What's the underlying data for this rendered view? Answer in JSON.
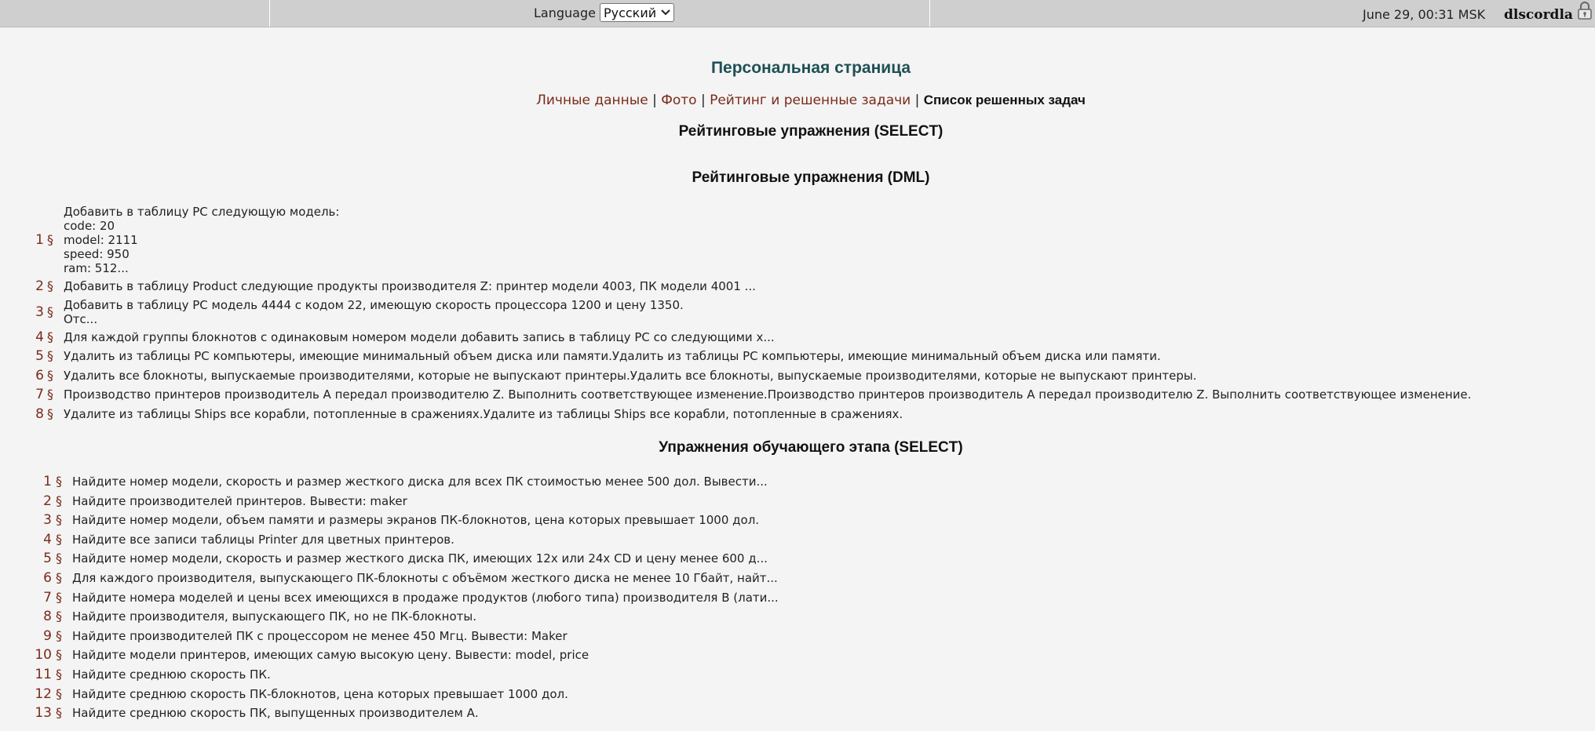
{
  "topbar": {
    "language_label": "Language",
    "language_selected": "Русский",
    "datetime": "June 29, 00:31 MSK",
    "username": "dlscordla"
  },
  "page": {
    "title": "Персональная страница",
    "nav": {
      "personal": "Личные данные",
      "photo": "Фото",
      "rating": "Рейтинг и решенные задачи",
      "solved_list": "Список решенных задач"
    }
  },
  "sections": {
    "rating_select": "Рейтинговые упражнения (SELECT)",
    "rating_dml": "Рейтинговые упражнения (DML)",
    "training_select": "Упражнения обучающего этапа (SELECT)"
  },
  "dml_items": [
    {
      "num": "1",
      "text": "Добавить в таблицу PC следующую модель:\ncode: 20\nmodel: 2111\nspeed: 950\nram: 512..."
    },
    {
      "num": "2",
      "text": "Добавить в таблицу Product следующие продукты производителя Z: принтер модели 4003, ПК модели 4001 ..."
    },
    {
      "num": "3",
      "text": "Добавить в таблицу PC модель 4444 с кодом 22, имеющую скорость процессора 1200 и цену 1350.\nОтс..."
    },
    {
      "num": "4",
      "text": "Для каждой группы блокнотов с одинаковым номером модели добавить запись в таблицу PC со следующими х..."
    },
    {
      "num": "5",
      "text": "Удалить из таблицы PC компьютеры, имеющие минимальный объем диска или памяти.Удалить из таблицы PC компьютеры, имеющие минимальный объем диска или памяти."
    },
    {
      "num": "6",
      "text": "Удалить все блокноты, выпускаемые производителями, которые не выпускают принтеры.Удалить все блокноты, выпускаемые производителями, которые не выпускают принтеры."
    },
    {
      "num": "7",
      "text": "Производство принтеров производитель A передал производителю Z. Выполнить соответствующее изменение.Производство принтеров производитель A передал производителю Z. Выполнить соответствующее изменение."
    },
    {
      "num": "8",
      "text": "Удалите из таблицы Ships все корабли, потопленные в сражениях.Удалите из таблицы Ships все корабли, потопленные в сражениях."
    }
  ],
  "training_items": [
    {
      "num": "1",
      "text": "Найдите номер модели, скорость и размер жесткого диска для всех ПК стоимостью менее 500 дол. Вывести..."
    },
    {
      "num": "2",
      "text": "Найдите производителей принтеров. Вывести: maker"
    },
    {
      "num": "3",
      "text": "Найдите номер модели, объем памяти и размеры экранов ПК-блокнотов, цена которых превышает 1000 дол."
    },
    {
      "num": "4",
      "text": "Найдите все записи таблицы Printer для цветных принтеров."
    },
    {
      "num": "5",
      "text": "Найдите номер модели, скорость и размер жесткого диска ПК, имеющих 12x или 24x CD и цену менее 600 д..."
    },
    {
      "num": "6",
      "text": "Для каждого производителя, выпускающего ПК-блокноты с объёмом жесткого диска не менее 10 Гбайт, найт..."
    },
    {
      "num": "7",
      "text": "Найдите номера моделей и цены всех имеющихся в продаже продуктов (любого типа) производителя B (лати..."
    },
    {
      "num": "8",
      "text": "Найдите производителя, выпускающего ПК, но не ПК-блокноты."
    },
    {
      "num": "9",
      "text": "Найдите производителей ПК с процессором не менее 450 Мгц. Вывести: Maker"
    },
    {
      "num": "10",
      "text": "Найдите модели принтеров, имеющих самую высокую цену. Вывести: model, price"
    },
    {
      "num": "11",
      "text": "Найдите среднюю скорость ПК."
    },
    {
      "num": "12",
      "text": "Найдите среднюю скорость ПК-блокнотов, цена которых превышает 1000 дол."
    },
    {
      "num": "13",
      "text": "Найдите среднюю скорость ПК, выпущенных производителем А."
    }
  ],
  "symbols": {
    "section_sign": "§",
    "pipe": "|"
  },
  "colors": {
    "link": "#7a2a1a",
    "title": "#1f4f55",
    "topbar": "#cfcfcf",
    "background": "#f4f4f4"
  },
  "icons": {
    "lock": "lock-icon",
    "dropdown": "chevron-down-icon"
  }
}
